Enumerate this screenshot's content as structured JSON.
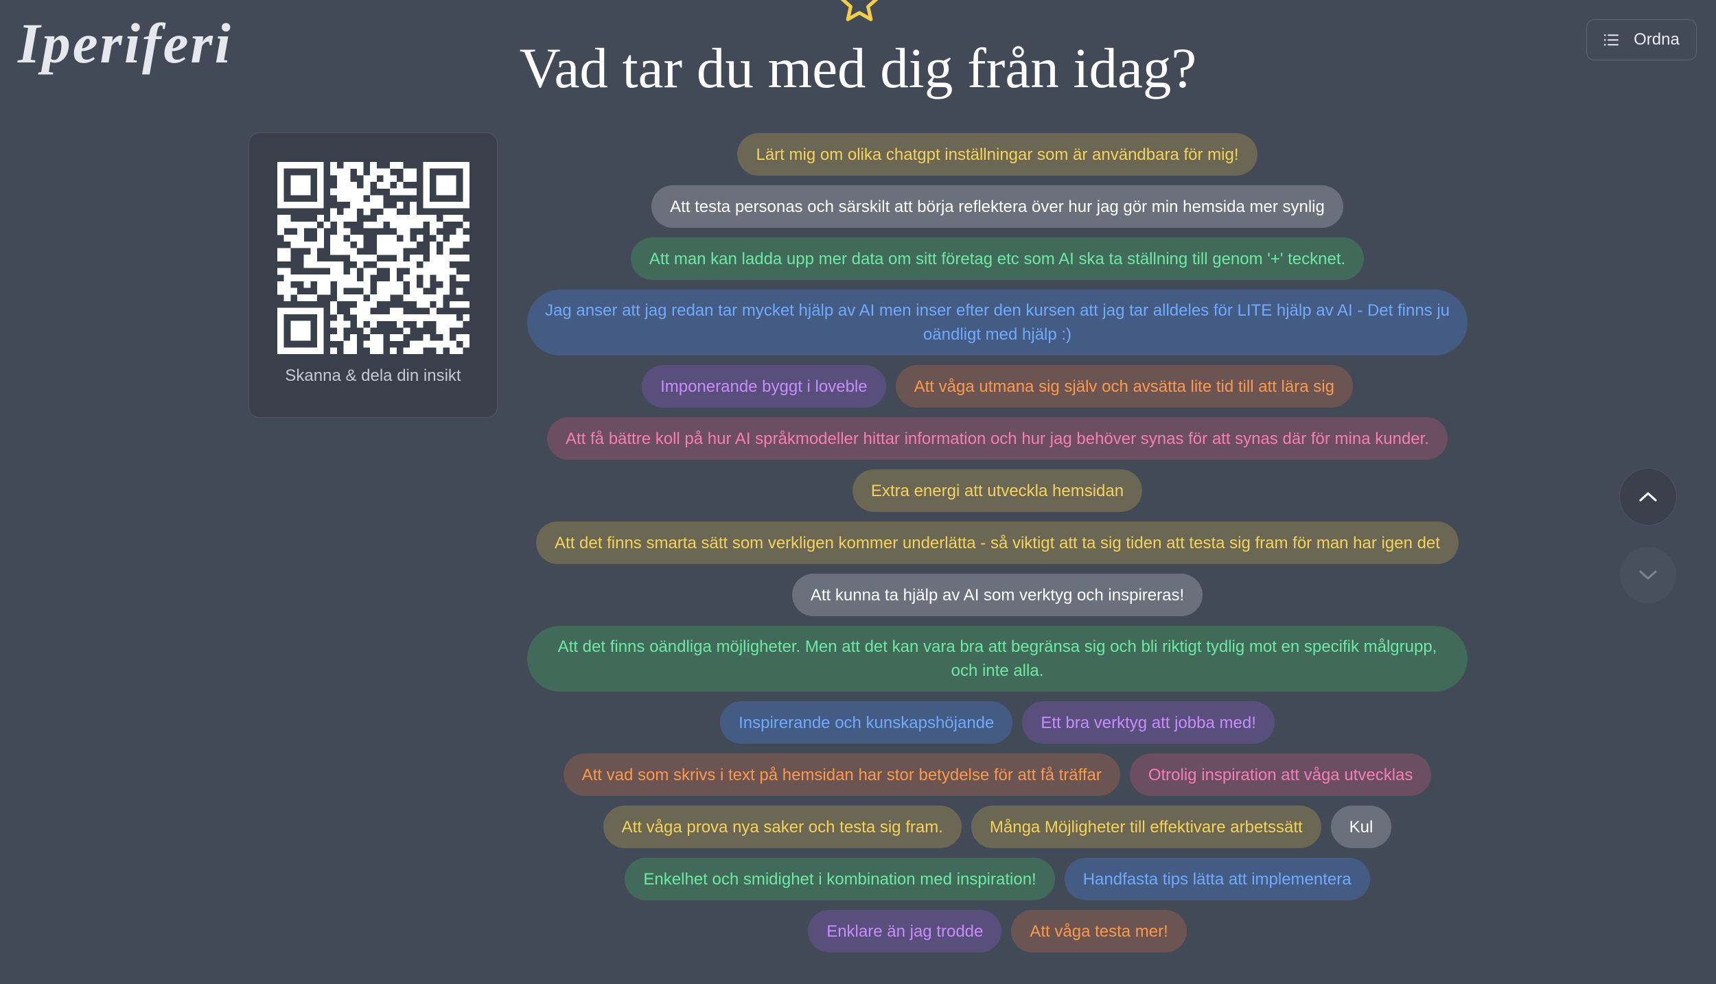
{
  "logo": "Iperiferi",
  "title": "Vad tar du med dig från idag?",
  "order_button": {
    "label": "Ordna",
    "icon": "list-icon"
  },
  "qr": {
    "caption": "Skanna & dela din insikt",
    "icon": "qr-code"
  },
  "colors": {
    "background": "#434a57",
    "star": "#f4cd4a",
    "yellow": "#f4d35c",
    "green": "#6de9a2",
    "blue": "#70aafc",
    "purple": "#c88cfc",
    "orange": "#fb9a4d",
    "pink": "#f57eb6"
  },
  "insights": [
    {
      "text": "Lärt mig om olika chatgpt inställningar som är användbara för mig!",
      "color": "yellow"
    },
    {
      "text": "Att testa personas och särskilt att börja reflektera över hur jag gör min hemsida mer synlig",
      "color": "gray"
    },
    {
      "text": "Att man kan ladda upp mer data om sitt företag etc som AI ska ta ställning till genom '+' tecknet.",
      "color": "green"
    },
    {
      "text": "Jag anser att jag redan tar mycket hjälp av AI men inser efter den kursen att jag tar alldeles för LITE hjälp av AI - Det finns ju oändligt med hjälp :)",
      "color": "blue"
    },
    {
      "text": "Imponerande byggt i loveble",
      "color": "purple"
    },
    {
      "text": "Att våga utmana sig själv och avsätta lite tid till att lära sig",
      "color": "orange"
    },
    {
      "text": "Att få bättre koll på hur AI språkmodeller hittar information och hur jag behöver synas för att synas där för mina kunder.",
      "color": "pink"
    },
    {
      "text": "Extra energi att utveckla hemsidan",
      "color": "yellow"
    },
    {
      "text": "Att det finns smarta sätt som verkligen kommer underlätta - så viktigt att ta sig tiden att testa sig fram för man har igen det",
      "color": "yellow"
    },
    {
      "text": "Att kunna ta hjälp av AI som verktyg och inspireras!",
      "color": "gray"
    },
    {
      "text": "Att det finns oändliga möjligheter. Men att det kan vara bra att begränsa sig och bli riktigt tydlig mot en specifik målgrupp, och inte alla.",
      "color": "green"
    },
    {
      "text": "Inspirerande och kunskapshöjande",
      "color": "blue"
    },
    {
      "text": "Ett bra verktyg att jobba med!",
      "color": "purple"
    },
    {
      "text": "Att vad som skrivs i text på hemsidan har stor betydelse för att få träffar",
      "color": "orange"
    },
    {
      "text": "Otrolig inspiration att våga utvecklas",
      "color": "pink"
    },
    {
      "text": "Att våga prova nya saker och testa sig fram.",
      "color": "yellow"
    },
    {
      "text": "Många Möjligheter till effektivare arbetssätt",
      "color": "yellow"
    },
    {
      "text": "Kul",
      "color": "gray"
    },
    {
      "text": "Enkelhet och smidighet i kombination med inspiration!",
      "color": "green"
    },
    {
      "text": "Handfasta tips lätta att implementera",
      "color": "blue"
    },
    {
      "text": "Enklare än jag trodde",
      "color": "purple"
    },
    {
      "text": "Att våga testa mer!",
      "color": "orange"
    }
  ],
  "nav": {
    "up_icon": "chevron-up-icon",
    "down_icon": "chevron-down-icon"
  }
}
